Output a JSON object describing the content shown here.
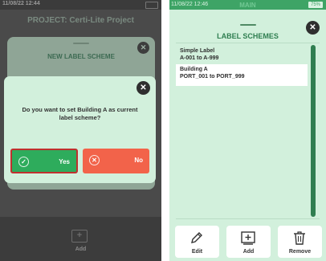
{
  "left_screen": {
    "status": {
      "time": "11/08/22 12:44"
    },
    "project_title": "PROJECT: Certi-Lite Project",
    "sheet_title": "NEW LABEL SCHEME",
    "dialog": {
      "question": "Do you want to set Building A as current label scheme?",
      "yes_label": "Yes",
      "no_label": "No"
    },
    "bottom_add_label": "Add"
  },
  "right_screen": {
    "status": {
      "time": "11/08/22 12:46",
      "mode": "MAIN",
      "battery": "75%"
    },
    "title": "LABEL SCHEMES",
    "items": [
      {
        "name": "Simple Label",
        "range": "A-001 to A-999",
        "selected": false
      },
      {
        "name": "Building A",
        "range": "PORT_001 to PORT_999",
        "selected": true
      }
    ],
    "actions": {
      "edit": "Edit",
      "add": "Add",
      "remove": "Remove"
    }
  },
  "colors": {
    "accent_green": "#2eac5c",
    "no_red": "#f2634a",
    "highlight_border": "#c0302e",
    "panel_mint": "#d2f0dc"
  }
}
